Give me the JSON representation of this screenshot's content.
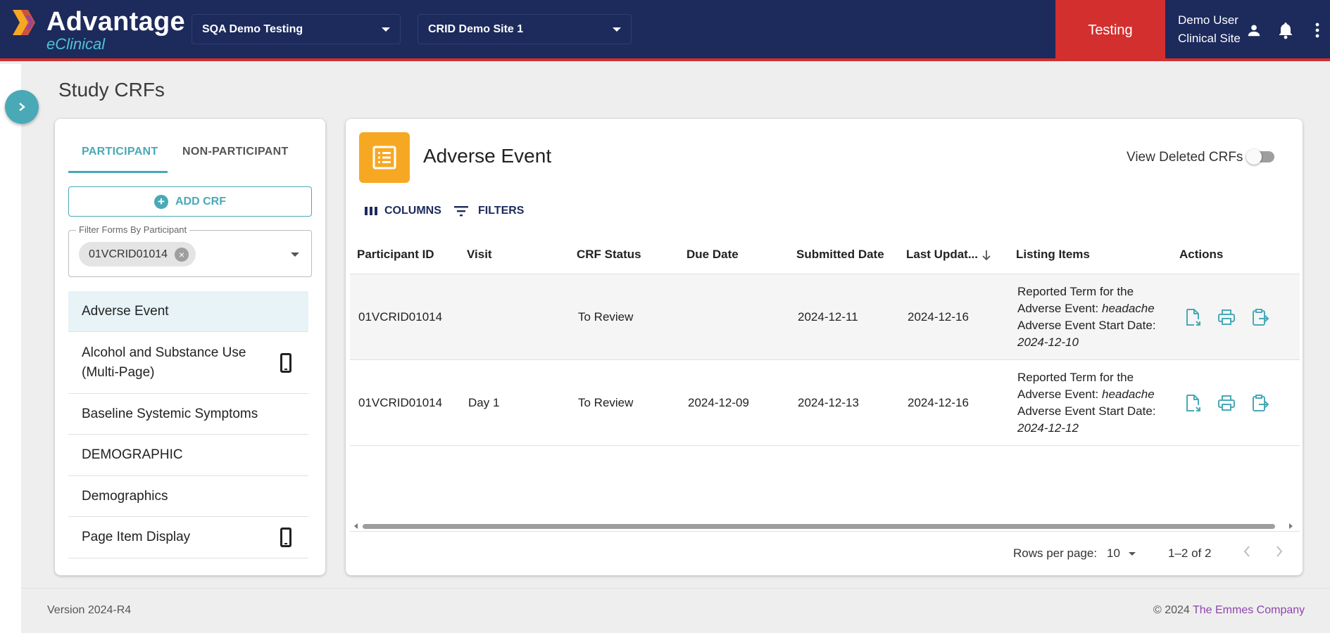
{
  "header": {
    "logo_main": "Advantage",
    "logo_sub": "eClinical",
    "study_select": "SQA Demo Testing",
    "site_select": "CRID Demo Site 1",
    "environment": "Testing",
    "user_name": "Demo User",
    "user_role": "Clinical Site",
    "icons": [
      "person-icon",
      "bell-icon",
      "more-vert-icon"
    ],
    "colors": {
      "bar": "#1c2a5c",
      "environment": "#d32f2f"
    }
  },
  "page": {
    "title": "Study CRFs"
  },
  "left_panel": {
    "tabs": [
      {
        "label": "PARTICIPANT",
        "active": true
      },
      {
        "label": "NON-PARTICIPANT",
        "active": false
      }
    ],
    "add_crf_label": "ADD CRF",
    "filter_label": "Filter Forms By Participant",
    "filter_chip": "01VCRID01014",
    "forms": [
      {
        "label": "Adverse Event",
        "mobile": false,
        "active": true
      },
      {
        "label": "Alcohol and Substance Use (Multi-Page)",
        "mobile": true,
        "active": false
      },
      {
        "label": "Baseline Systemic Symptoms",
        "mobile": false,
        "active": false
      },
      {
        "label": "DEMOGRAPHIC",
        "mobile": false,
        "active": false
      },
      {
        "label": "Demographics",
        "mobile": false,
        "active": false
      },
      {
        "label": "Page Item Display",
        "mobile": true,
        "active": false
      }
    ]
  },
  "main": {
    "crf_title": "Adverse Event",
    "crf_icon": "list-form-icon",
    "crf_icon_color": "#f7a823",
    "view_deleted_label": "View Deleted CRFs",
    "view_deleted_on": false,
    "toolbar": {
      "columns_label": "COLUMNS",
      "filters_label": "FILTERS"
    },
    "columns": [
      "Participant ID",
      "Visit",
      "CRF Status",
      "Due Date",
      "Submitted Date",
      "Last Updat...",
      "Listing Items",
      "Actions"
    ],
    "sort": {
      "column": "Last Updat...",
      "direction": "desc"
    },
    "rows": [
      {
        "participant_id": "01VCRID01014",
        "visit": "",
        "crf_status": "To Review",
        "due_date": "",
        "submitted_date": "2024-12-11",
        "last_updated": "2024-12-16",
        "listing": {
          "term_label_1": "Reported Term for the",
          "term_label_2": "Adverse Event:",
          "term_value": "headache",
          "start_label": "Adverse Event Start Date:",
          "start_value": "2024-12-10"
        }
      },
      {
        "participant_id": "01VCRID01014",
        "visit": "Day 1",
        "crf_status": "To Review",
        "due_date": "2024-12-09",
        "submitted_date": "2024-12-13",
        "last_updated": "2024-12-16",
        "listing": {
          "term_label_1": "Reported Term for the",
          "term_label_2": "Adverse Event:",
          "term_value": "headache",
          "start_label": "Adverse Event Start Date:",
          "start_value": "2024-12-12"
        }
      }
    ],
    "action_icons": [
      "open-form-icon",
      "print-icon",
      "transfer-icon"
    ],
    "pagination": {
      "rows_per_page_label": "Rows per page:",
      "rows_per_page": "10",
      "range": "1–2 of 2"
    }
  },
  "footer": {
    "version": "Version 2024-R4",
    "copyright": "© 2024",
    "company": "The Emmes Company"
  }
}
